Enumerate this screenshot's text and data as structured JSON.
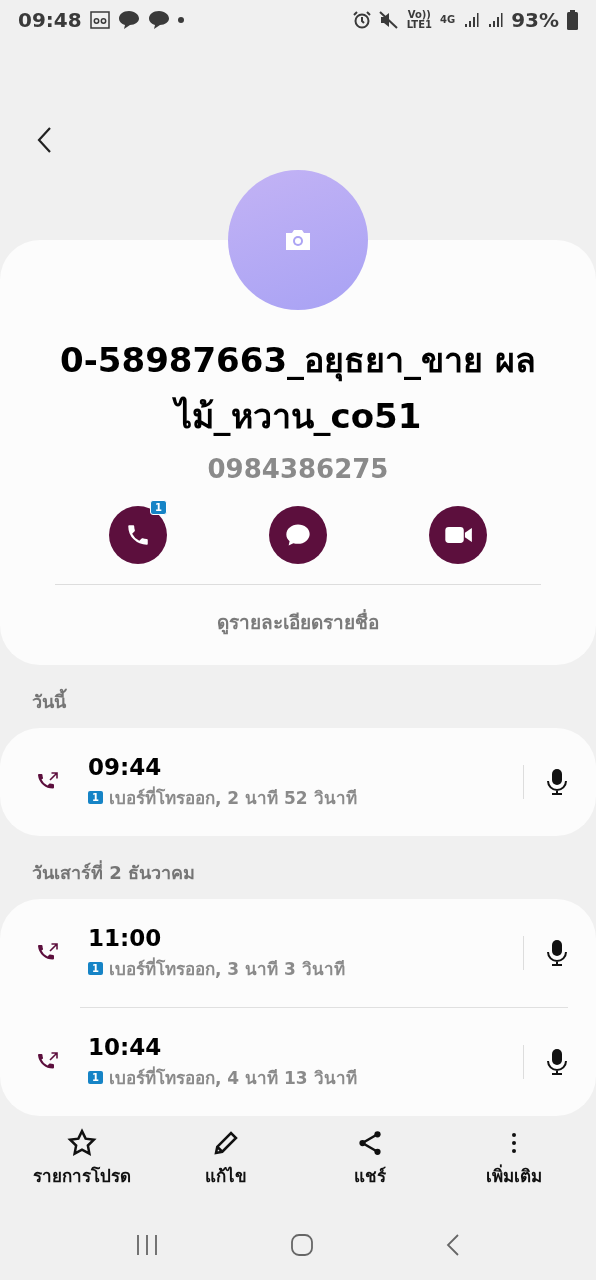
{
  "status_bar": {
    "time": "09:48",
    "network": [
      "Vo))",
      "LTE1",
      "4G"
    ],
    "battery": "93%"
  },
  "contact": {
    "name": "0-58987663_อยุธยา_ขาย ผลไม้_หวาน_co51",
    "number": "0984386275",
    "actions": [
      {
        "kind": "call",
        "badge": "1"
      },
      {
        "kind": "message"
      },
      {
        "kind": "video"
      }
    ],
    "details_link": "ดูรายละเอียดรายชื่อ"
  },
  "call_groups": [
    {
      "date": "วันนี้",
      "calls": [
        {
          "kind": "outgoing",
          "time": "09:44",
          "sim": "1",
          "detail": "เบอร์ที่โทรออก, 2 นาที 52 วินาที"
        }
      ]
    },
    {
      "date": "วันเสาร์ที่ 2 ธันวาคม",
      "calls": [
        {
          "kind": "outgoing",
          "time": "11:00",
          "sim": "1",
          "detail": "เบอร์ที่โทรออก, 3 นาที 3 วินาที"
        },
        {
          "kind": "outgoing",
          "time": "10:44",
          "sim": "1",
          "detail": "เบอร์ที่โทรออก, 4 นาที 13 วินาที"
        }
      ]
    }
  ],
  "bottom_actions": [
    {
      "kind": "star",
      "label": "รายการโปรด"
    },
    {
      "kind": "edit",
      "label": "แก้ไข"
    },
    {
      "kind": "share",
      "label": "แชร์"
    },
    {
      "kind": "more",
      "label": "เพิ่มเติม"
    }
  ]
}
